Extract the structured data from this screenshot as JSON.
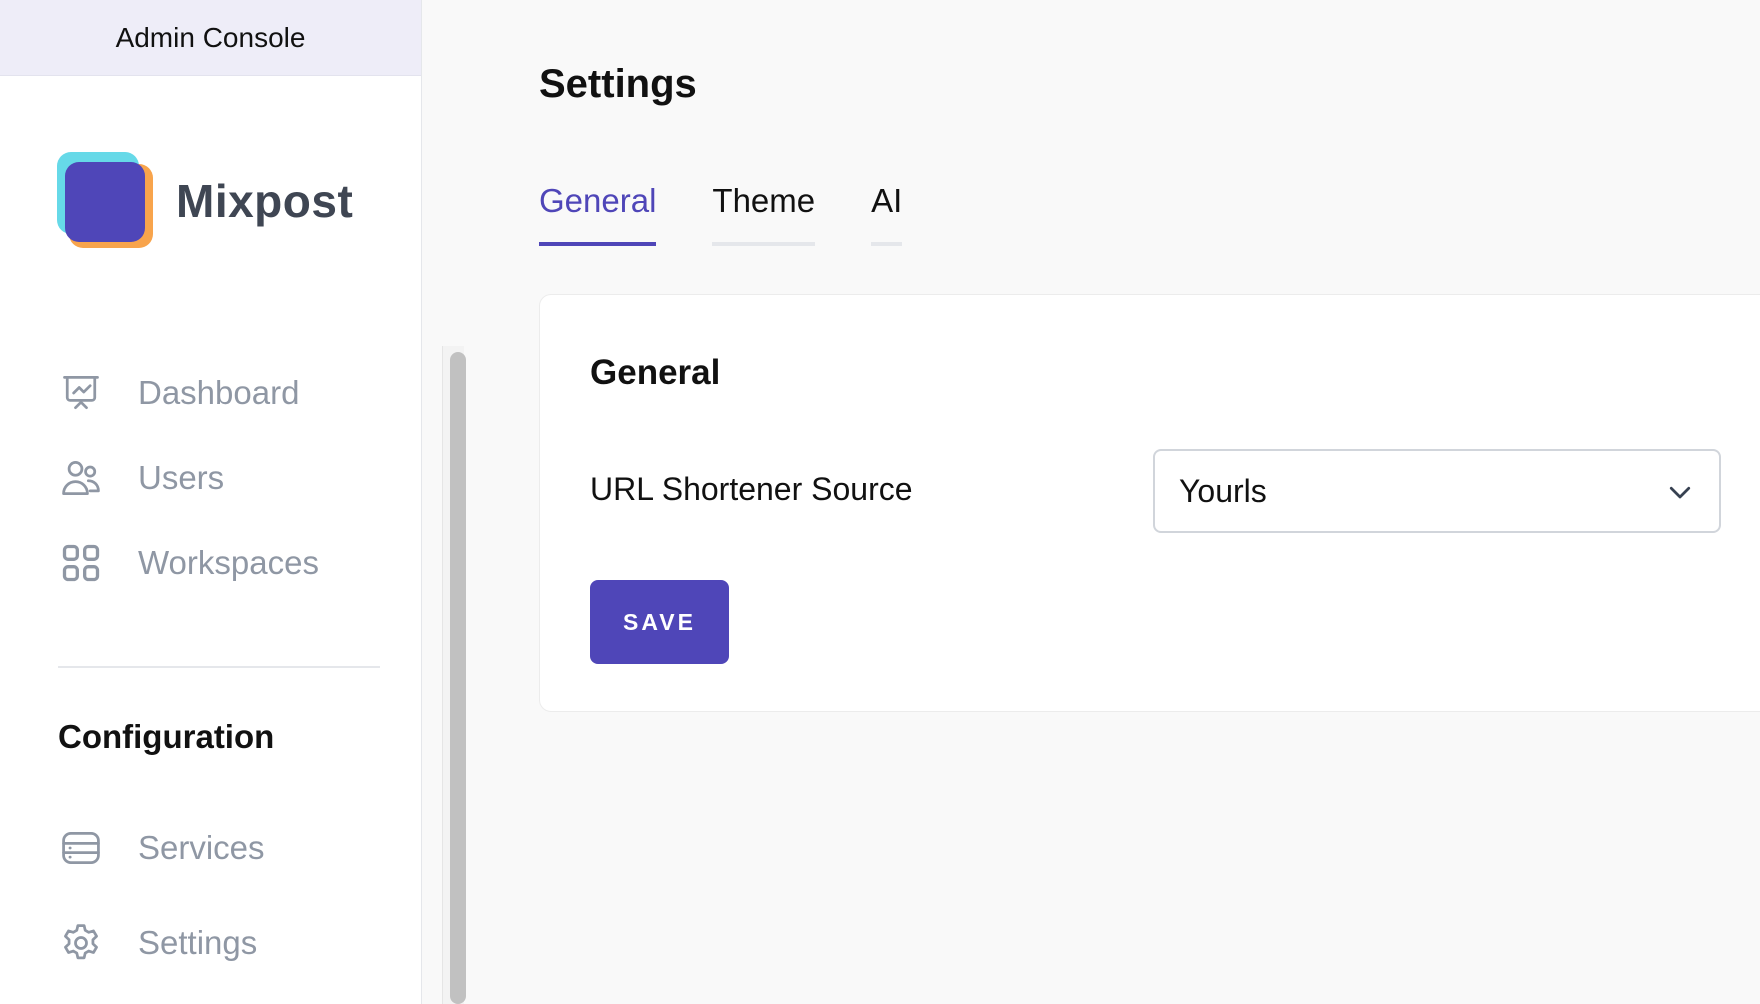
{
  "header": {
    "console_label": "Admin Console"
  },
  "brand": {
    "name": "Mixpost"
  },
  "sidebar": {
    "items": [
      {
        "label": "Dashboard",
        "icon": "presentation-chart-icon"
      },
      {
        "label": "Users",
        "icon": "users-icon"
      },
      {
        "label": "Workspaces",
        "icon": "grid-icon"
      }
    ],
    "section_title": "Configuration",
    "config_items": [
      {
        "label": "Services",
        "icon": "server-stack-icon"
      },
      {
        "label": "Settings",
        "icon": "gear-icon"
      }
    ]
  },
  "page": {
    "title": "Settings"
  },
  "tabs": [
    {
      "label": "General",
      "active": true
    },
    {
      "label": "Theme",
      "active": false
    },
    {
      "label": "AI",
      "active": false
    }
  ],
  "card": {
    "title": "General",
    "field_label": "URL Shortener Source",
    "select_value": "Yourls",
    "save_label": "SAVE"
  },
  "colors": {
    "accent": "#4f46b8",
    "nav_text": "#8f97a4",
    "console_bg": "#eeedf8"
  }
}
